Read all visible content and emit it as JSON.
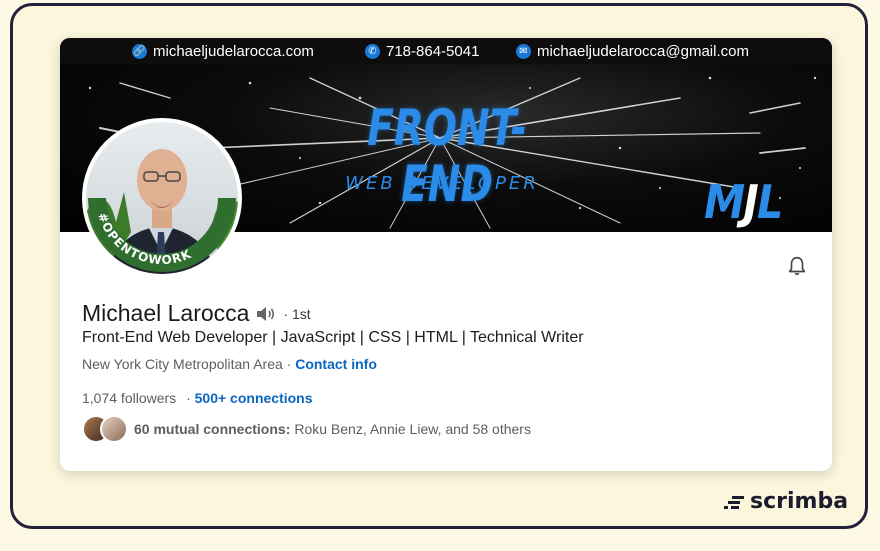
{
  "contact_bar": {
    "website": "michaeljudelarocca.com",
    "phone": "718-864-5041",
    "email": "michaeljudelarocca@gmail.com",
    "icons": [
      "link-icon",
      "phone-icon",
      "mail-icon"
    ]
  },
  "banner": {
    "title": "FRONT-END",
    "subtitle": "WEB DEVELOPER",
    "monogram_part1": "M",
    "monogram_part2": "J",
    "monogram_part3": "L"
  },
  "avatar": {
    "badge": "#OPENTOWORK",
    "badge_color": "#2f6e2f"
  },
  "profile": {
    "name": "Michael Larocca",
    "degree": "· 1st",
    "headline": "Front-End Web Developer | JavaScript | CSS | HTML | Technical Writer",
    "location": "New York City Metropolitan Area ·",
    "contact_info": "Contact info",
    "followers": "1,074 followers",
    "connections_sep": "·",
    "connections": "500+ connections",
    "mutual_label": "60 mutual connections:",
    "mutual_names": "Roku Benz, Annie Liew, and 58 others"
  },
  "brand": {
    "name": "scrimba"
  },
  "colors": {
    "linkedin_blue": "#0a66c2",
    "banner_blue": "#2a8be8",
    "frame": "#23223a",
    "background": "#fbf6dc"
  }
}
